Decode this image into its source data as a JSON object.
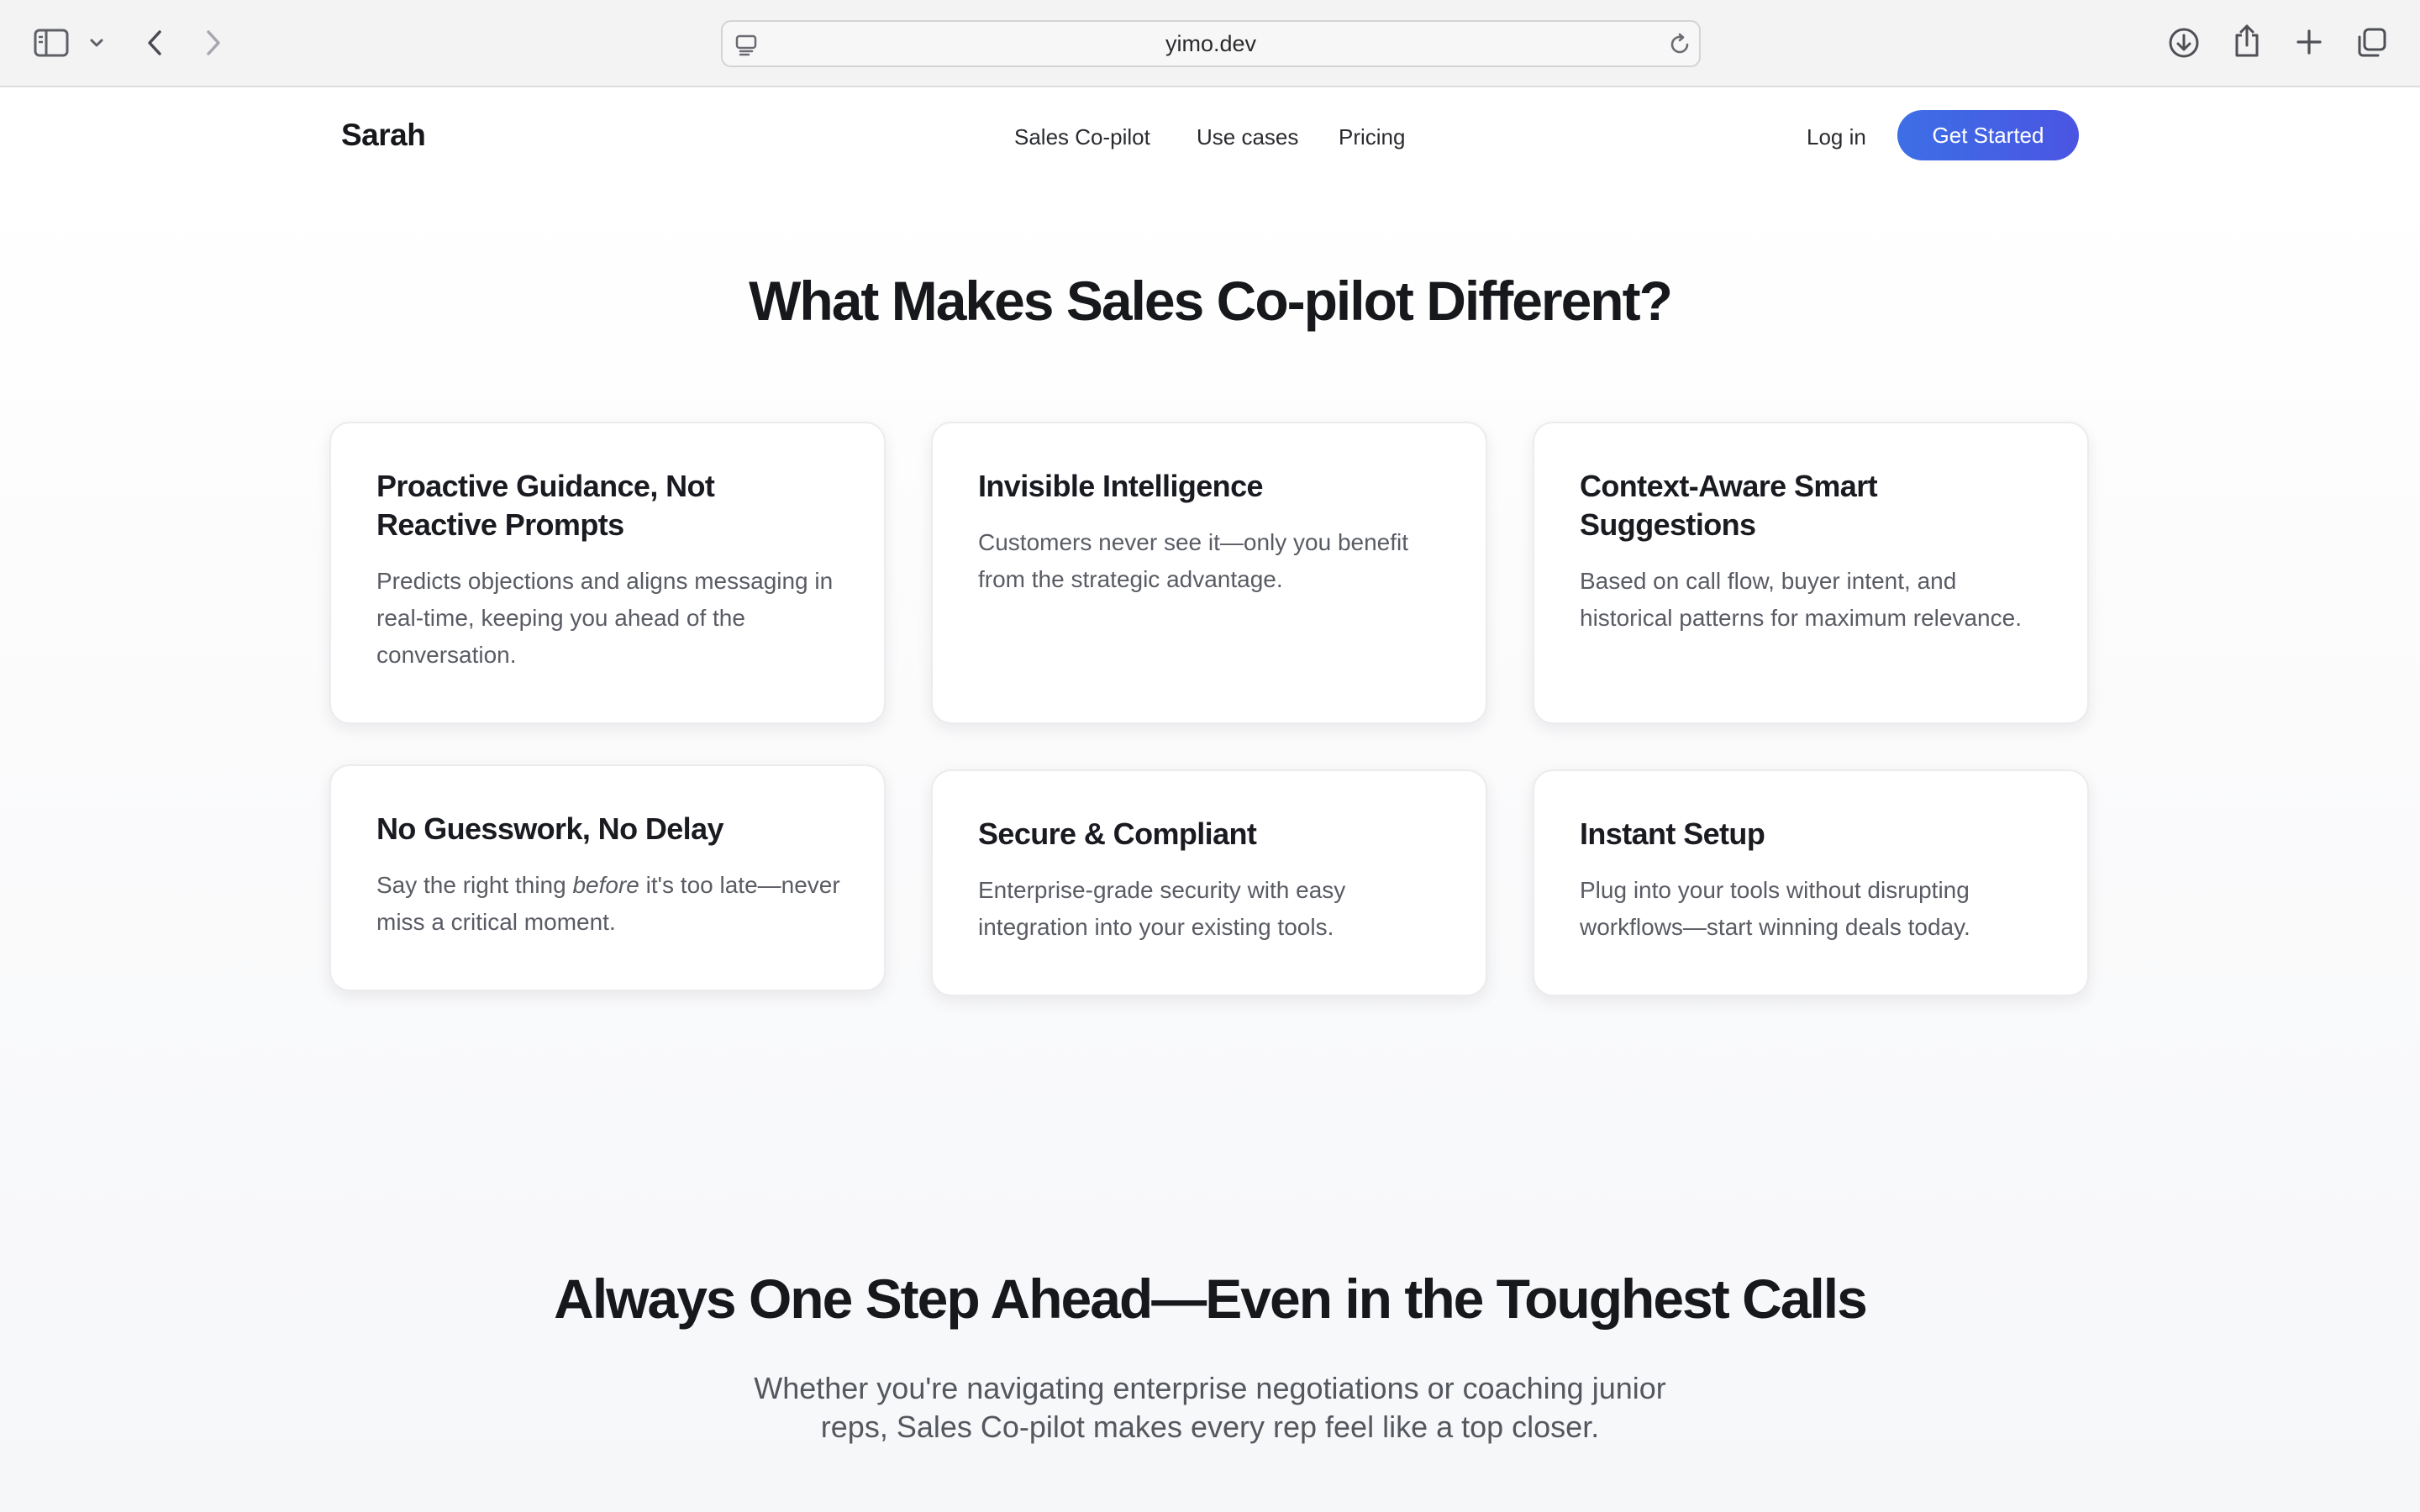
{
  "browser": {
    "url": "yimo.dev",
    "icons": [
      "sidebar-icon",
      "chevron-down-icon",
      "back-arrow-icon",
      "forward-arrow-icon",
      "site-settings-icon",
      "reload-icon",
      "download-icon",
      "share-icon",
      "new-tab-plus-icon",
      "tabs-overview-icon"
    ]
  },
  "header": {
    "brand": "Sarah",
    "nav": [
      "Sales Co-pilot",
      "Use cases",
      "Pricing"
    ],
    "login": "Log in",
    "cta": "Get Started"
  },
  "features": {
    "title": "What Makes Sales Co-pilot Different?",
    "cards": [
      {
        "title": "Proactive Guidance, Not Reactive Prompts",
        "body": "Predicts objections and aligns messaging in real-time, keeping you ahead of the conversation."
      },
      {
        "title": "Invisible Intelligence",
        "body": "Customers never see it—only you benefit from the strategic advantage."
      },
      {
        "title": "Context-Aware Smart Suggestions",
        "body": "Based on call flow, buyer intent, and historical patterns for maximum relevance."
      },
      {
        "title": "No Guesswork, No Delay",
        "body_before": "Say the right thing ",
        "body_emphasis": "before",
        "body_after": " it's too late—never miss a critical moment."
      },
      {
        "title": "Secure & Compliant",
        "body": "Enterprise-grade security with easy integration into your existing tools."
      },
      {
        "title": "Instant Setup",
        "body": "Plug into your tools without disrupting workflows—start winning deals today."
      }
    ]
  },
  "ahead": {
    "title": "Always One Step Ahead—Even in the Toughest Calls",
    "subtitle": "Whether you're navigating enterprise negotiations or coaching junior reps, Sales Co-pilot makes every rep feel like a top closer."
  },
  "colors": {
    "accent_start": "#3d6fe6",
    "accent_end": "#4a55e2",
    "text_primary": "#17181c",
    "text_secondary": "#5a5c64"
  }
}
